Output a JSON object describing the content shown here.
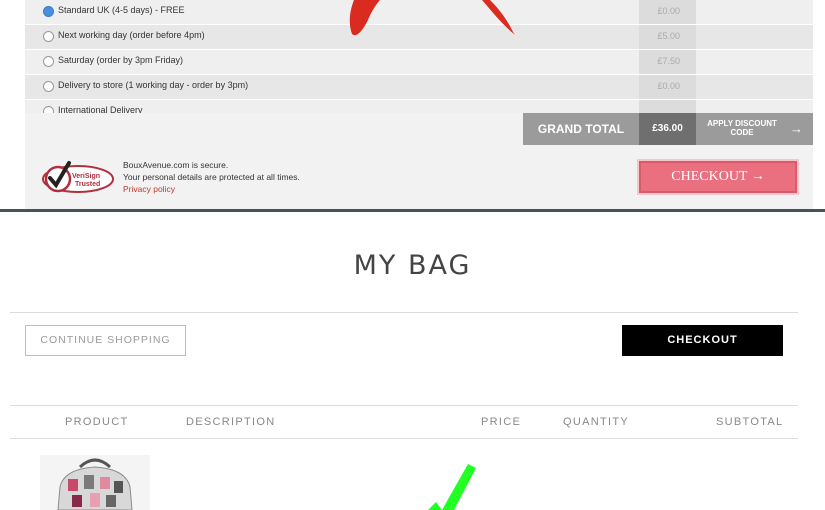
{
  "old_checkout": {
    "delivery_options": [
      {
        "label": "Standard UK (4-5 days) - FREE",
        "price": "£0.00",
        "selected": true
      },
      {
        "label": "Next working day (order before 4pm)",
        "price": "£5.00",
        "selected": false
      },
      {
        "label": "Saturday (order by 3pm Friday)",
        "price": "£7.50",
        "selected": false
      },
      {
        "label": "Delivery to store (1 working day - order by 3pm)",
        "price": "£0.00",
        "selected": false
      },
      {
        "label": "International Delivery",
        "price": "",
        "selected": false
      }
    ],
    "grand_total_label": "GRAND TOTAL",
    "grand_total_value": "£36.00",
    "discount_label": "APPLY DISCOUNT CODE",
    "secure_line1": "BouxAvenue.com is secure.",
    "secure_line2": "Your personal details are protected at all times.",
    "privacy_link": "Privacy policy",
    "verisign_text": "VeriSign Trusted",
    "checkout_label": "CHECKOUT →"
  },
  "new_bag": {
    "title": "MY BAG",
    "continue_label": "CONTINUE SHOPPING",
    "checkout_label": "CHECKOUT",
    "columns": [
      "PRODUCT",
      "DESCRIPTION",
      "PRICE",
      "QUANTITY",
      "SUBTOTAL"
    ]
  },
  "colors": {
    "old_checkout_button": "#ea6f7f",
    "cross_mark": "#d92b1f",
    "check_mark": "#22ff22",
    "new_checkout_button": "#000000"
  }
}
